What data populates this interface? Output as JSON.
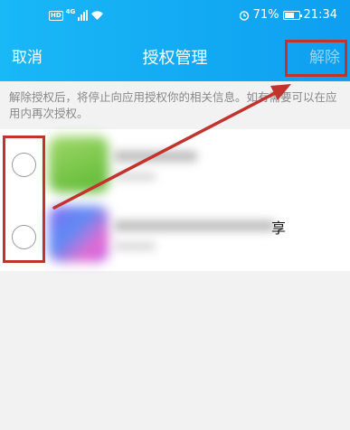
{
  "status_bar": {
    "hd": "HD",
    "network": "4G",
    "battery_percent": "71%",
    "battery_level": 0.71,
    "time": "21:34"
  },
  "nav": {
    "cancel": "取消",
    "title": "授权管理",
    "unbind": "解除"
  },
  "notice": "解除授权后，将停止向应用授权你的相关信息。如有需要可以在应用内再次授权。",
  "apps": [
    {
      "icon": "app-icon-green",
      "selected": false
    },
    {
      "icon": "app-icon-purple",
      "selected": false,
      "visible_name_tail": "享"
    }
  ],
  "annotations": {
    "highlight_color": "#c2332e"
  },
  "colors": {
    "header": "#19b8f7",
    "background": "#f2f2f2"
  }
}
